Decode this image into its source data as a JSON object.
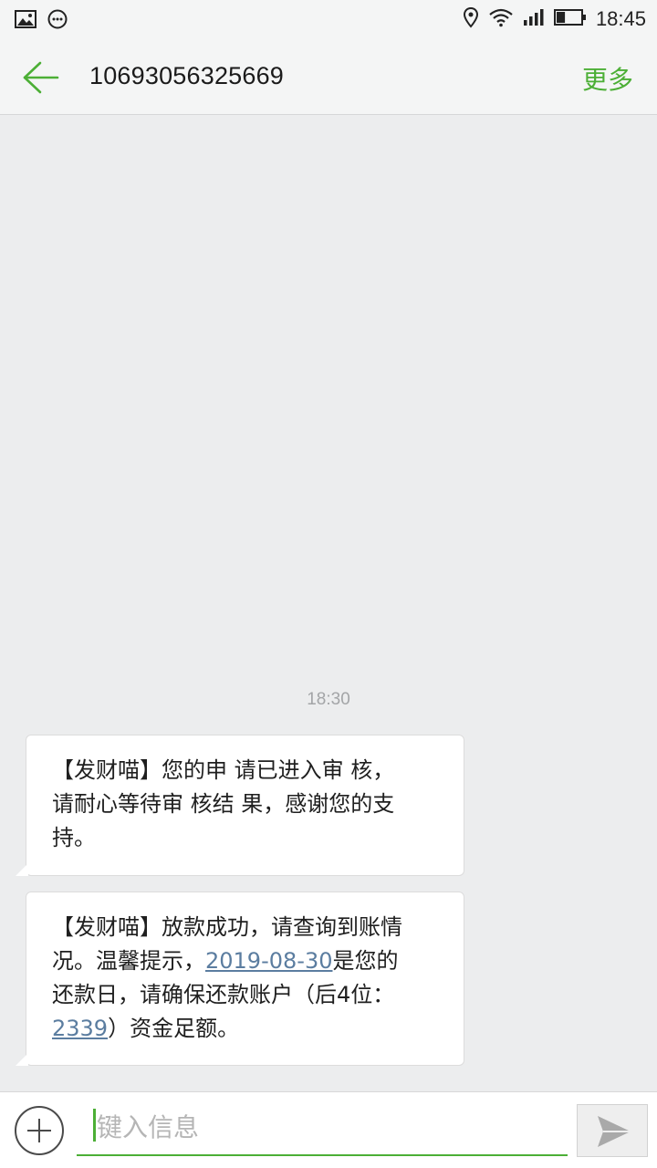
{
  "status_bar": {
    "time": "18:45",
    "icons": [
      "image-icon",
      "message-dots-icon",
      "location-icon",
      "wifi-icon",
      "signal-icon",
      "battery-icon"
    ],
    "battery_level": 0.35
  },
  "header": {
    "title": "10693056325669",
    "more_label": "更多"
  },
  "conversation": {
    "timestamp": "18:30",
    "messages": [
      {
        "lines": [
          "【发财喵】您的申 请已进入审 核，",
          "请耐心等待审 核结 果，感谢您的支",
          "持。"
        ]
      },
      {
        "line1": "【发财喵】放款成功，请查询到账情",
        "line2_prefix": "况。温馨提示，",
        "date_link": "2019-08-30",
        "line2_suffix": "是您的",
        "line3": "还款日，请确保还款账户（后4位：",
        "account_link": "2339",
        "line4_suffix": "）资金足额。"
      }
    ]
  },
  "input": {
    "placeholder": "键入信息",
    "value": ""
  },
  "colors": {
    "accent": "#4caf36",
    "link": "#5b7da0",
    "background": "#ecedee"
  }
}
